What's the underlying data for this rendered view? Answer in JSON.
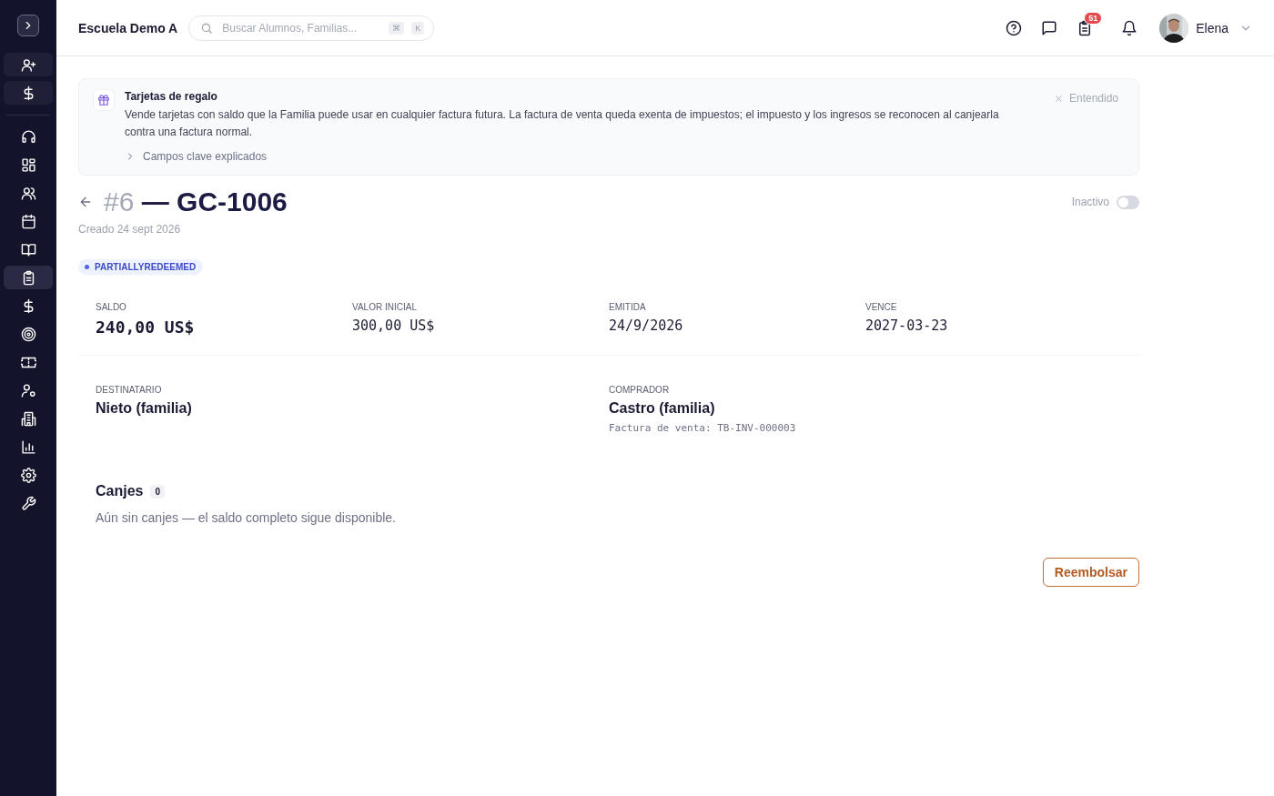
{
  "sidebar": {
    "nav_items": [
      {
        "selected": false
      },
      {
        "selected": false
      },
      {
        "selected": false
      },
      {
        "selected": false
      },
      {
        "selected": false
      },
      {
        "selected": true
      },
      {
        "selected": false
      },
      {
        "selected": false
      },
      {
        "selected": false
      },
      {
        "selected": false
      },
      {
        "selected": false
      },
      {
        "selected": false
      },
      {
        "selected": false
      },
      {
        "selected": false
      }
    ]
  },
  "header": {
    "school": "Escuela Demo A",
    "search": {
      "placeholder": "Buscar Alumnos, Familias...",
      "keys": [
        "⌘",
        "K"
      ]
    },
    "tasks_badge": "51",
    "user": "Elena"
  },
  "notice": {
    "title": "Tarjetas de regalo",
    "text": "Vende tarjetas con saldo que la Familia puede usar en cualquier factura futura. La factura de venta queda exenta de impuestos; el impuesto y los ingresos se reconocen al canjearla contra una factura normal.",
    "dismiss": "Entendido",
    "details": {
      "label": "Campos clave explicados",
      "expanded": false
    }
  },
  "title": {
    "number": "#6",
    "separator": "—",
    "code": "GC-1006",
    "created": "Creado 24 sept 2026"
  },
  "active_toggle": {
    "label": "Inactivo",
    "on": false
  },
  "status": "PARTIALLYREDEEMED",
  "stats": [
    {
      "label": "SALDO",
      "value": "240,00 US$",
      "emphasized": true
    },
    {
      "label": "VALOR INICIAL",
      "value": "300,00 US$",
      "emphasized": false
    },
    {
      "label": "EMITIDA",
      "value": "24/9/2026",
      "emphasized": false
    },
    {
      "label": "VENCE",
      "value": "2027-03-23",
      "emphasized": false
    }
  ],
  "parties": [
    {
      "label": "DESTINATARIO",
      "name": "Nieto (familia)"
    },
    {
      "label": "COMPRADOR",
      "name": "Castro (familia)",
      "note": "Factura de venta: TB-INV-000003"
    }
  ],
  "redemptions": {
    "title": "Canjes",
    "count": "0",
    "empty": "Aún sin canjes — el saldo completo sigue disponible."
  },
  "refund_button": "Reembolsar"
}
